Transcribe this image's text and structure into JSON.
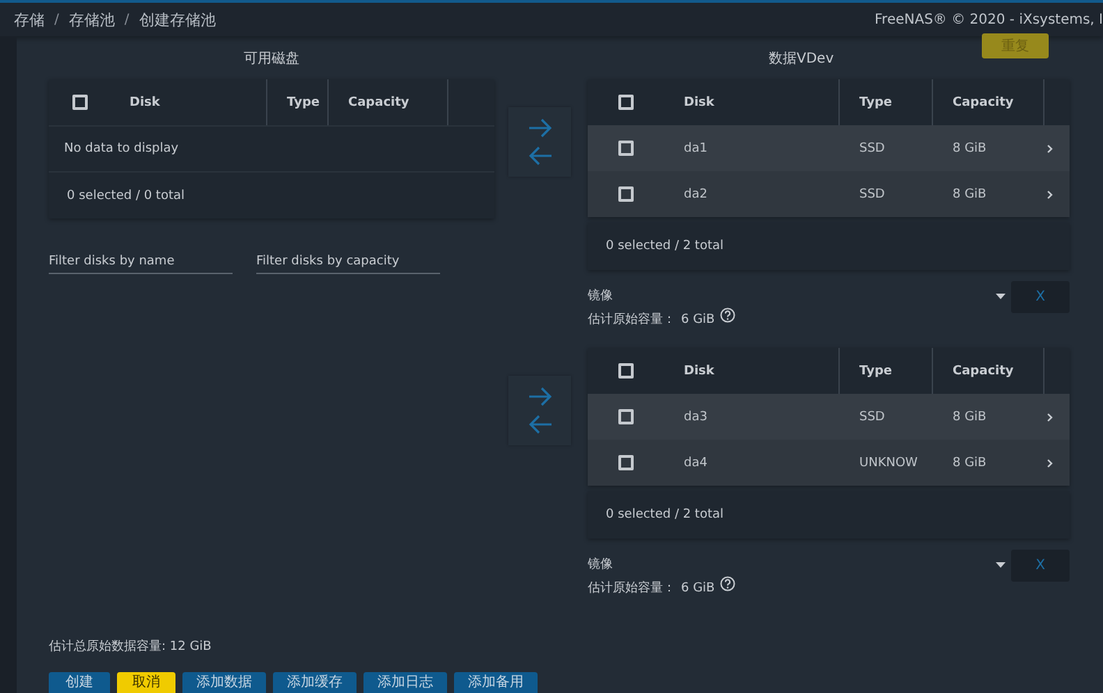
{
  "breadcrumb": [
    "存储",
    "存储池",
    "创建存储池"
  ],
  "breadcrumb_separator": "/",
  "copyright": "FreeNAS® © 2020 - iXsystems, I",
  "available": {
    "title": "可用磁盘",
    "columns": [
      "Disk",
      "Type",
      "Capacity"
    ],
    "header_checked": false,
    "empty": "No data to display",
    "footer": "0 selected / 0 total",
    "filters": [
      {
        "placeholder": "Filter disks by name"
      },
      {
        "placeholder": "Filter disks by capacity"
      }
    ]
  },
  "data_vdevs": {
    "title": "数据VDev",
    "repeat_button": "重复",
    "vdevs": [
      {
        "columns": [
          "Disk",
          "Type",
          "Capacity"
        ],
        "header_checked": false,
        "rows": [
          {
            "disk": "da1",
            "type": "SSD",
            "capacity": "8 GiB",
            "checked": false
          },
          {
            "disk": "da2",
            "type": "SSD",
            "capacity": "8 GiB",
            "checked": false
          }
        ],
        "footer": "0 selected / 2 total",
        "layout": "镜像",
        "capacity_label": "估计原始容量：",
        "capacity": "6 GiB",
        "remove_button": "X"
      },
      {
        "columns": [
          "Disk",
          "Type",
          "Capacity"
        ],
        "header_checked": false,
        "rows": [
          {
            "disk": "da3",
            "type": "SSD",
            "capacity": "8 GiB",
            "checked": false
          },
          {
            "disk": "da4",
            "type": "UNKNOW",
            "capacity": "8 GiB",
            "checked": false
          }
        ],
        "footer": "0 selected / 2 total",
        "layout": "镜像",
        "capacity_label": "估计原始容量：",
        "capacity": "6 GiB",
        "remove_button": "X"
      }
    ]
  },
  "total": "估计总原始数据容量: 12 GiB",
  "buttons": [
    {
      "label": "创建",
      "kind": "primary"
    },
    {
      "label": "取消",
      "kind": "warning"
    },
    {
      "label": "添加数据",
      "kind": "primary"
    },
    {
      "label": "添加缓存",
      "kind": "primary"
    },
    {
      "label": "添加日志",
      "kind": "primary"
    },
    {
      "label": "添加备用",
      "kind": "primary"
    }
  ]
}
